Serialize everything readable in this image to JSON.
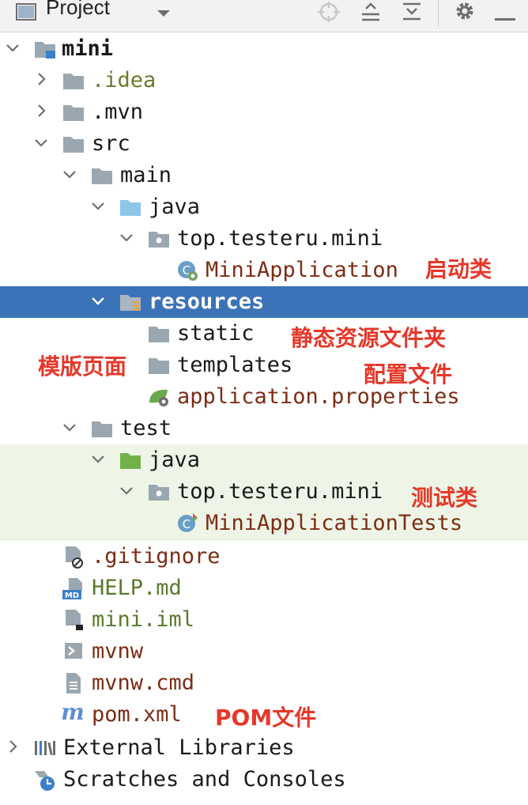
{
  "toolbar": {
    "title": "Project",
    "icons": [
      "project-view-icon",
      "dropdown-icon",
      "locate-icon",
      "expand-all-icon",
      "collapse-all-icon",
      "gear-icon",
      "hide-icon"
    ]
  },
  "tree": [
    {
      "name": "mini",
      "depth": 0,
      "expanded": true,
      "icon": "module-folder"
    },
    {
      "name": ".idea",
      "depth": 1,
      "expanded": false,
      "icon": "folder"
    },
    {
      "name": ".mvn",
      "depth": 1,
      "expanded": false,
      "icon": "folder"
    },
    {
      "name": "src",
      "depth": 1,
      "expanded": true,
      "icon": "folder"
    },
    {
      "name": "main",
      "depth": 2,
      "expanded": true,
      "icon": "folder"
    },
    {
      "name": "java",
      "depth": 3,
      "expanded": true,
      "icon": "source-folder"
    },
    {
      "name": "top.testeru.mini",
      "depth": 4,
      "expanded": true,
      "icon": "package"
    },
    {
      "name": "MiniApplication",
      "depth": 5,
      "icon": "spring-class"
    },
    {
      "name": "resources",
      "depth": 3,
      "expanded": true,
      "icon": "resources-folder",
      "selected": true
    },
    {
      "name": "static",
      "depth": 4,
      "icon": "folder"
    },
    {
      "name": "templates",
      "depth": 4,
      "icon": "folder"
    },
    {
      "name": "application.properties",
      "depth": 4,
      "icon": "spring-properties"
    },
    {
      "name": "test",
      "depth": 2,
      "expanded": true,
      "icon": "folder"
    },
    {
      "name": "java",
      "depth": 3,
      "expanded": true,
      "icon": "test-folder"
    },
    {
      "name": "top.testeru.mini",
      "depth": 4,
      "expanded": true,
      "icon": "package"
    },
    {
      "name": "MiniApplicationTests",
      "depth": 5,
      "icon": "test-class"
    },
    {
      "name": ".gitignore",
      "depth": 1,
      "icon": "ignore-file"
    },
    {
      "name": "HELP.md",
      "depth": 1,
      "icon": "markdown-file"
    },
    {
      "name": "mini.iml",
      "depth": 1,
      "icon": "iml-file"
    },
    {
      "name": "mvnw",
      "depth": 1,
      "icon": "shell-file"
    },
    {
      "name": "mvnw.cmd",
      "depth": 1,
      "icon": "text-file"
    },
    {
      "name": "pom.xml",
      "depth": 1,
      "icon": "maven-file"
    },
    {
      "name": "External Libraries",
      "depth": 0,
      "expanded": false,
      "icon": "libraries"
    },
    {
      "name": "Scratches and Consoles",
      "depth": 0,
      "icon": "scratches"
    }
  ],
  "annotations": {
    "startup_class": "启动类",
    "static_resources": "静态资源文件夹",
    "template_pages": "模版页面",
    "config_file": "配置文件",
    "test_class": "测试类",
    "pom_file": "POM文件"
  },
  "colors": {
    "selection": "#3b73b9",
    "test_band": "#eef5e7",
    "annotation": "#e5382a",
    "vcs_modified": "#7c2d14",
    "vcs_added": "#5a7a2e"
  }
}
